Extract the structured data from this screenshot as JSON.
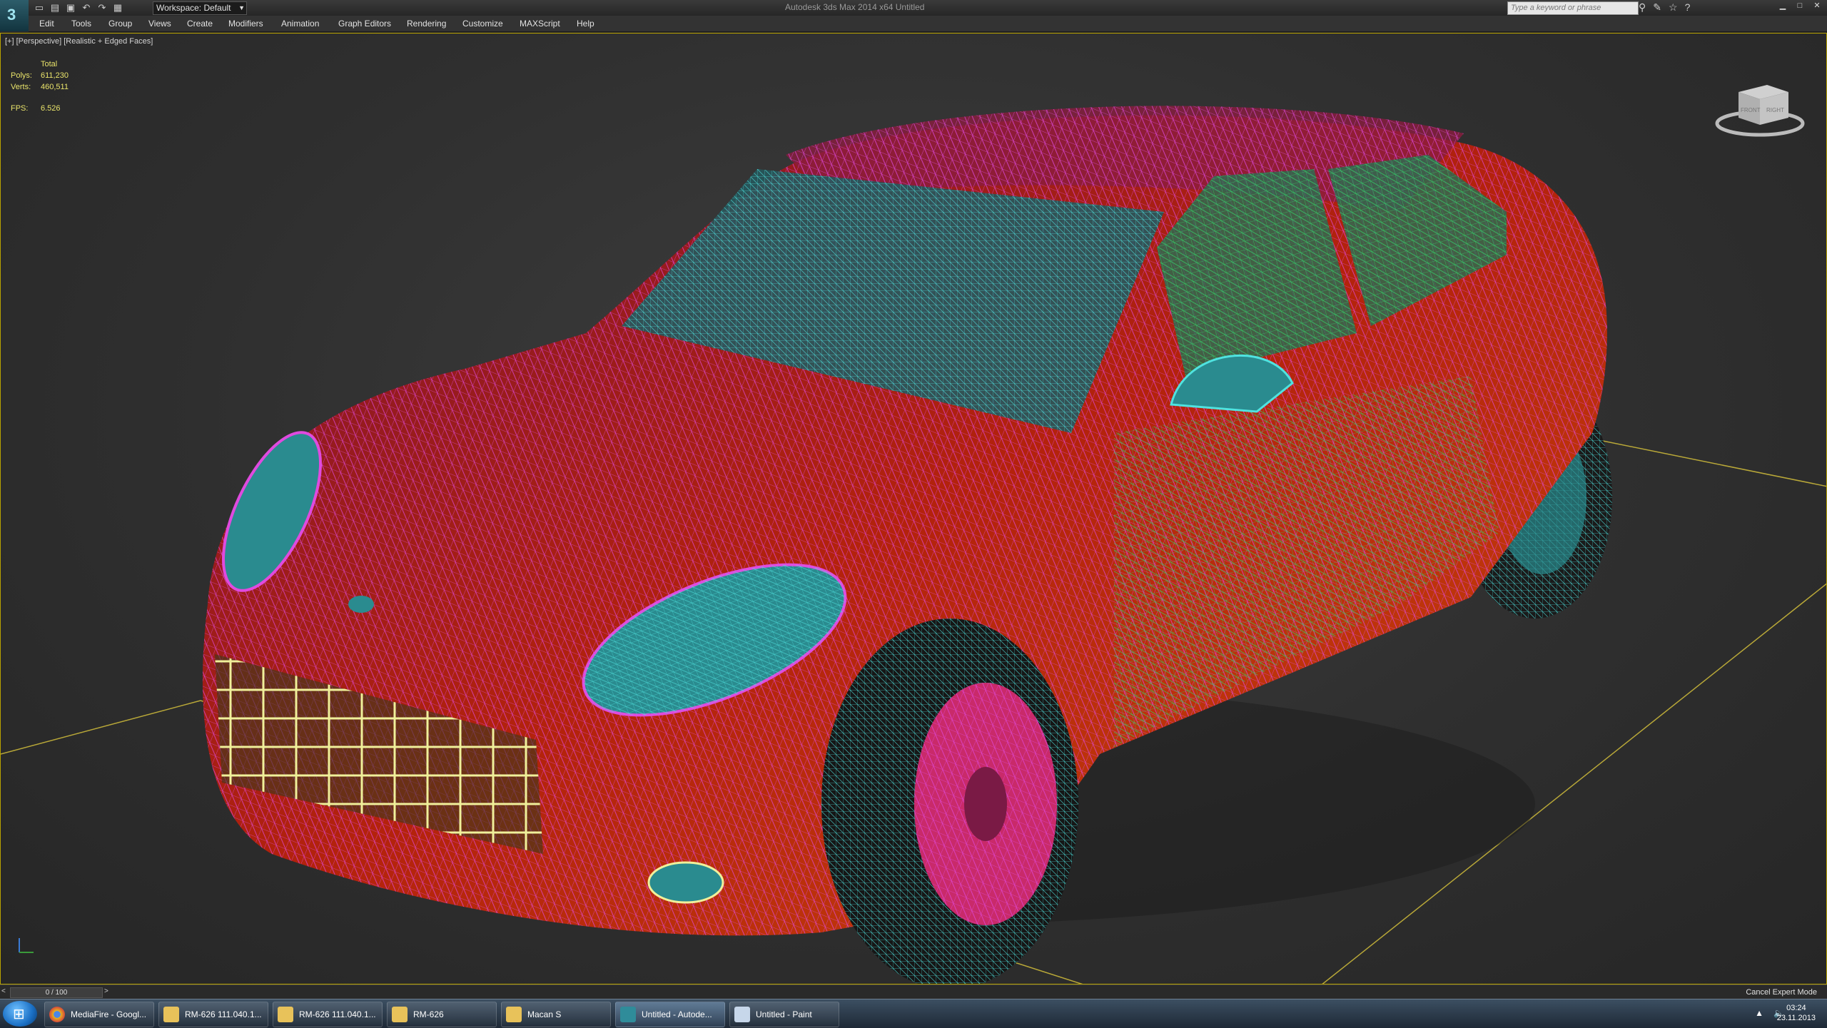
{
  "app": {
    "window_title": "Autodesk 3ds Max  2014 x64     Untitled",
    "logo_glyph": "3",
    "workspace": "Workspace: Default",
    "search_placeholder": "Type a keyword or phrase",
    "quick_access_icons": [
      "new-file-icon",
      "open-file-icon",
      "save-icon",
      "undo-icon",
      "redo-icon",
      "project-folder-icon"
    ],
    "info_icons": [
      "binoculars-icon",
      "search-tools-icon",
      "star-icon",
      "help-icon"
    ],
    "window_controls": [
      "minimize-icon",
      "maximize-icon",
      "close-icon"
    ]
  },
  "menu": [
    "Edit",
    "Tools",
    "Group",
    "Views",
    "Create",
    "Modifiers",
    "Animation",
    "Graph Editors",
    "Rendering",
    "Customize",
    "MAXScript",
    "Help"
  ],
  "viewport": {
    "label": "[+] [Perspective] [Realistic + Edged Faces]",
    "stats": {
      "header": "Total",
      "polys_label": "Polys:",
      "polys": "611,230",
      "verts_label": "Verts:",
      "verts": "460,511",
      "fps_label": "FPS:",
      "fps": "6.526"
    },
    "viewcube_faces": [
      "FRONT",
      "RIGHT"
    ],
    "colors": {
      "border": "#b8a200",
      "body": "#b4220c",
      "wire_magenta": "#e04adf",
      "wire_green": "#34d36a",
      "wire_cyan": "#4fe3e0",
      "wheel_pink": "#e0307a",
      "glass": "#2a8b8f"
    }
  },
  "timeline": {
    "position": "0 / 100",
    "prev": "<",
    "next": ">",
    "expert_mode": "Cancel Expert Mode"
  },
  "taskbar": {
    "items": [
      {
        "label": "MediaFire - Googl...",
        "icon": "chrome-icon",
        "color": "#e6b320"
      },
      {
        "label": "RM-626 111.040.1...",
        "icon": "folder-icon",
        "color": "#e8c25a"
      },
      {
        "label": "RM-626 111.040.1...",
        "icon": "folder-icon",
        "color": "#e8c25a"
      },
      {
        "label": "RM-626",
        "icon": "folder-icon",
        "color": "#e8c25a"
      },
      {
        "label": "Macan S",
        "icon": "folder-icon",
        "color": "#e8c25a"
      },
      {
        "label": "Untitled - Autode...",
        "icon": "3dsmax-icon",
        "color": "#2f8c9a"
      },
      {
        "label": "Untitled - Paint",
        "icon": "paint-icon",
        "color": "#c7d7ea"
      }
    ],
    "tray_icons": [
      "show-hidden-icon",
      "volume-icon"
    ],
    "time": "03:24",
    "date": "23.11.2013"
  }
}
